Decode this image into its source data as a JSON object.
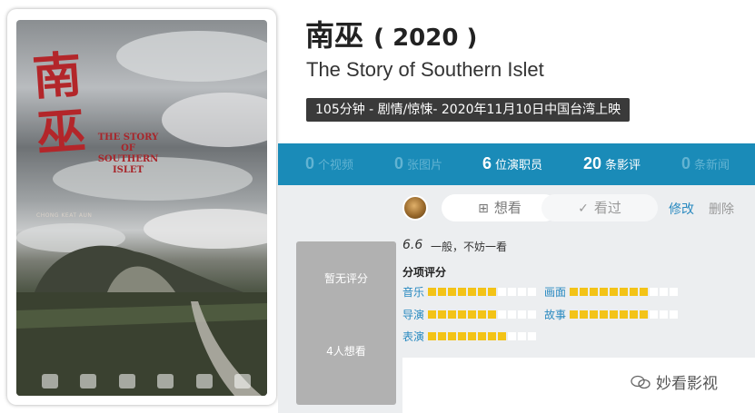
{
  "movie": {
    "title_cn": "南巫",
    "year": "( 2020 )",
    "title_en": "The Story of Southern Islet",
    "meta": "105分钟 - 剧情/惊悚- 2020年11月10日中国台湾上映"
  },
  "poster": {
    "title_cn_top": "南",
    "title_cn_bottom": "巫",
    "title_en": "THE STORY OF SOUTHERN ISLET",
    "credit": "CHONG KEAT AUN"
  },
  "stats": [
    {
      "num": "0",
      "label": "个视频"
    },
    {
      "num": "0",
      "label": "张图片"
    },
    {
      "num": "6",
      "label": "位演职员"
    },
    {
      "num": "20",
      "label": "条影评"
    },
    {
      "num": "0",
      "label": "条新闻"
    }
  ],
  "actions": {
    "want": "想看",
    "seen": "看过",
    "edit": "修改",
    "delete": "删除"
  },
  "score_box": {
    "no_rating": "暂无评分",
    "wants": "4人想看"
  },
  "user_score": {
    "value": "6.6",
    "text": "一般，不妨一看"
  },
  "sub_ratings": {
    "title": "分项评分",
    "items": [
      {
        "label": "音乐",
        "filled": 7,
        "total": 11
      },
      {
        "label": "画面",
        "filled": 8,
        "total": 11
      },
      {
        "label": "导演",
        "filled": 7,
        "total": 11
      },
      {
        "label": "故事",
        "filled": 8,
        "total": 11
      },
      {
        "label": "表演",
        "filled": 8,
        "total": 11
      }
    ]
  },
  "watermark": "妙看影视",
  "colors": {
    "stats_bar": "#1a8bb8",
    "rating_on": "#f3c317",
    "link": "#2a8ac0"
  }
}
